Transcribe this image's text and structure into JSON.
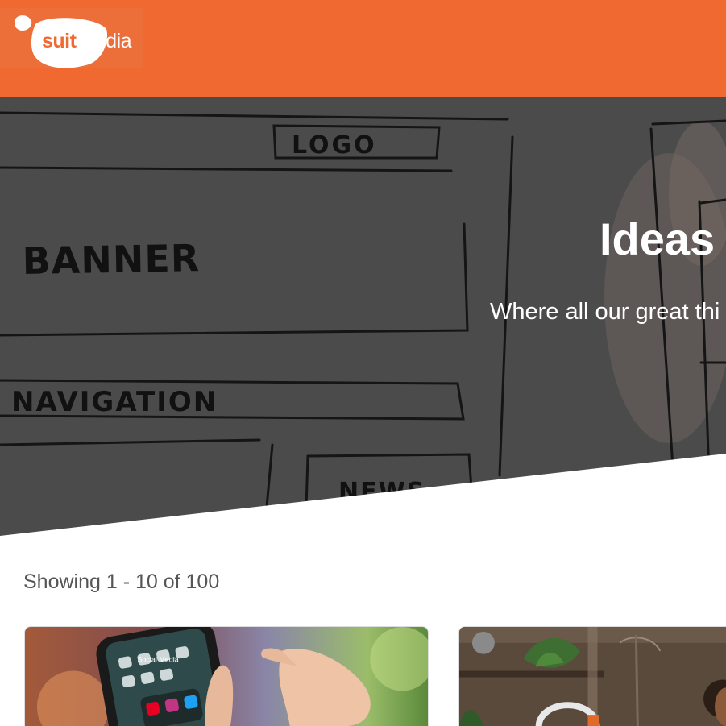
{
  "header": {
    "brand_primary": "suit",
    "brand_secondary": "media",
    "background_color": "#ef6930"
  },
  "hero": {
    "title": "Ideas",
    "subtitle": "Where all our great thi",
    "sketch_labels": {
      "logo": "LOGO",
      "banner": "BANNER",
      "navigation": "NAVIGATION",
      "news": "NEWS"
    }
  },
  "results": {
    "showing_text": "Showing 1 - 10 of 100"
  },
  "cards": [
    {
      "id": "card-1",
      "screen_text": "Social Media"
    },
    {
      "id": "card-2"
    }
  ],
  "colors": {
    "accent": "#ef6930",
    "hero_overlay": "#4b4b4c",
    "text_muted": "#555555"
  }
}
